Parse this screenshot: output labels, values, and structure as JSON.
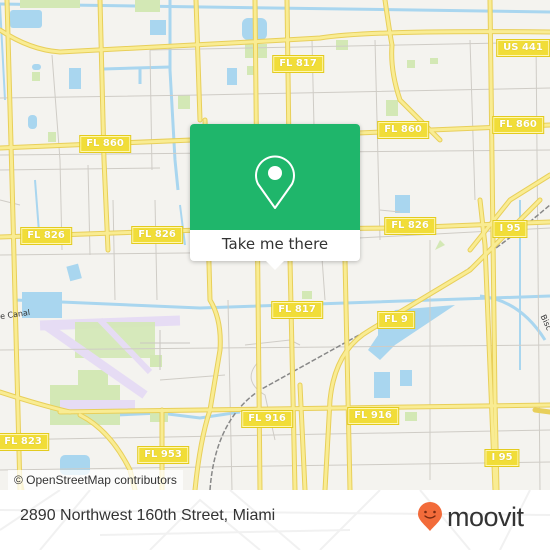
{
  "map": {
    "colors": {
      "land": "#f4f3ef",
      "water": "#a9d6ef",
      "park": "#d3e8b5",
      "road_major": "#f6e27a",
      "road_minor": "#c9c6c0",
      "airport": "#e6dcf4",
      "shield_bg": "#f1dd38"
    },
    "route_labels": [
      {
        "id": "fl817-top",
        "text": "FL 817"
      },
      {
        "id": "us441",
        "text": "US 441"
      },
      {
        "id": "fl860-left",
        "text": "FL 860"
      },
      {
        "id": "fl860-mid",
        "text": "FL 860"
      },
      {
        "id": "fl860-right",
        "text": "FL 860"
      },
      {
        "id": "fl826-left",
        "text": "FL 826"
      },
      {
        "id": "fl826-mid",
        "text": "FL 826"
      },
      {
        "id": "fl826-right",
        "text": "FL 826"
      },
      {
        "id": "i95-top",
        "text": "I 95"
      },
      {
        "id": "fl817-mid",
        "text": "FL 817"
      },
      {
        "id": "fl9",
        "text": "FL 9"
      },
      {
        "id": "fl916-left",
        "text": "FL 916"
      },
      {
        "id": "fl916-mid",
        "text": "FL 916"
      },
      {
        "id": "fl823",
        "text": "FL 823"
      },
      {
        "id": "fl953",
        "text": "FL 953"
      },
      {
        "id": "i95-bottom",
        "text": "I 95"
      }
    ],
    "water_labels": [
      {
        "id": "canal-left",
        "text": "e Canal"
      },
      {
        "id": "canal-right",
        "text": "Bisc"
      }
    ],
    "attribution": "© OpenStreetMap contributors"
  },
  "popup": {
    "icon": "location-pin-icon",
    "cta_label": "Take me there",
    "color": "#1fb66b"
  },
  "footer": {
    "address": "2890 Northwest 160th Street, Miami",
    "brand": "moovit",
    "brand_icon": "moovit-smiley-pin-icon",
    "brand_color": "#f26b3a"
  }
}
